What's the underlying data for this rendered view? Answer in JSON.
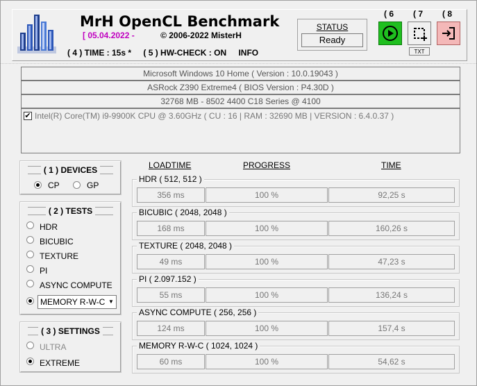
{
  "header": {
    "title": "MrH OpenCL Benchmark",
    "date": "[ 05.04.2022 -",
    "copyright": "©  2006-2022 MisterH",
    "time_option": "( 4 ) TIME : 15s *",
    "hwcheck_option": "( 5 ) HW-CHECK : ON",
    "info_label": "INFO"
  },
  "status": {
    "label": "STATUS",
    "value": "Ready"
  },
  "toolbar": {
    "run_number": "( 6",
    "snapshot_number": "( 7",
    "exit_number": "( 8",
    "txt_label": "TXT",
    "run_color": "#1fbf1f",
    "exit_color": "#f4b8b8"
  },
  "system": {
    "os": "Microsoft Windows 10 Home ( Version : 10.0.19043 )",
    "board": "ASRock Z390 Extreme4 ( BIOS Version : P4.30D )",
    "memory": "32768 MB - 8502 4400 C18 Series     @ 4100",
    "cpu": "Intel(R) Core(TM) i9-9900K CPU @ 3.60GHz ( CU : 16 | RAM : 32690 MB | VERSION : 6.4.0.37 )"
  },
  "devices": {
    "title": "( 1 ) DEVICES",
    "options": [
      {
        "label": "CP",
        "selected": true
      },
      {
        "label": "GP",
        "selected": false
      }
    ]
  },
  "tests": {
    "title": "( 2 ) TESTS",
    "options": [
      {
        "label": "HDR",
        "selected": false
      },
      {
        "label": "BICUBIC",
        "selected": false
      },
      {
        "label": "TEXTURE",
        "selected": false
      },
      {
        "label": "PI",
        "selected": false
      },
      {
        "label": "ASYNC COMPUTE",
        "selected": false
      }
    ],
    "dropdown_value": "MEMORY R-W-C"
  },
  "settings": {
    "title": "( 3 ) SETTINGS",
    "options": [
      {
        "label": "ULTRA",
        "selected": false
      },
      {
        "label": "EXTREME",
        "selected": true
      }
    ]
  },
  "columns": {
    "loadtime": "LOADTIME",
    "progress": "PROGRESS",
    "time": "TIME"
  },
  "results": [
    {
      "name": "HDR ( 512, 512 )",
      "loadtime": "356 ms",
      "progress": "100 %",
      "time": "92,25 s"
    },
    {
      "name": "BICUBIC ( 2048, 2048 )",
      "loadtime": "168 ms",
      "progress": "100 %",
      "time": "160,26 s"
    },
    {
      "name": "TEXTURE ( 2048, 2048 )",
      "loadtime": "49 ms",
      "progress": "100 %",
      "time": "47,23 s"
    },
    {
      "name": "PI ( 2.097.152 )",
      "loadtime": "55 ms",
      "progress": "100 %",
      "time": "136,24 s"
    },
    {
      "name": "ASYNC COMPUTE ( 256, 256 )",
      "loadtime": "124 ms",
      "progress": "100 %",
      "time": "157,4 s"
    },
    {
      "name": "MEMORY R-W-C ( 1024, 1024 )",
      "loadtime": "60 ms",
      "progress": "100 %",
      "time": "54,62 s"
    }
  ]
}
